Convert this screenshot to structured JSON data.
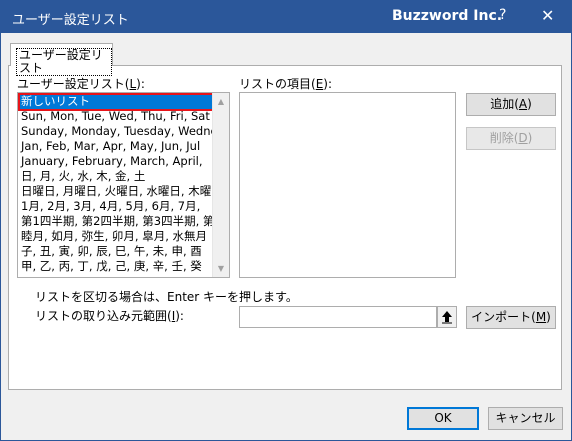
{
  "window": {
    "title": "ユーザー設定リスト",
    "brand": "Buzzword Inc.",
    "help": "?",
    "close": "✕"
  },
  "tab": {
    "label": "ユーザー設定リスト"
  },
  "custom_lists": {
    "label_prefix": "ユーザー設定リスト(",
    "label_key": "L",
    "label_suffix": "):",
    "items": [
      "新しいリスト",
      "Sun, Mon, Tue, Wed, Thu, Fri, Sat",
      "Sunday, Monday, Tuesday, Wednesday",
      "Jan, Feb, Mar, Apr, May, Jun, Jul",
      "January, February, March, April,",
      "日, 月, 火, 水, 木, 金, 土",
      "日曜日, 月曜日, 火曜日, 水曜日, 木曜",
      "1月, 2月, 3月, 4月, 5月, 6月, 7月,",
      "第1四半期, 第2四半期, 第3四半期, 第",
      "睦月, 如月, 弥生, 卯月, 皐月, 水無月",
      "子, 丑, 寅, 卯, 辰, 巳, 午, 未, 申, 酉",
      "甲, 乙, 丙, 丁, 戊, 己, 庚, 辛, 壬, 癸"
    ],
    "selected_index": 0
  },
  "list_entries": {
    "label_prefix": "リストの項目(",
    "label_key": "E",
    "label_suffix": "):",
    "value": ""
  },
  "buttons": {
    "add_prefix": "追加(",
    "add_key": "A",
    "add_suffix": ")",
    "delete_prefix": "削除(",
    "delete_key": "D",
    "delete_suffix": ")",
    "import_prefix": "インポート(",
    "import_key": "M",
    "import_suffix": ")",
    "ok": "OK",
    "cancel": "キャンセル"
  },
  "hint": {
    "text": "リストを区切る場合は、Enter キーを押します。"
  },
  "import_range": {
    "label_prefix": "リストの取り込み元範囲(",
    "label_key": "I",
    "label_suffix": "):",
    "value": ""
  },
  "colors": {
    "titlebar": "#2b579a",
    "selection": "#0078d7",
    "highlight_border": "#e8141a"
  }
}
